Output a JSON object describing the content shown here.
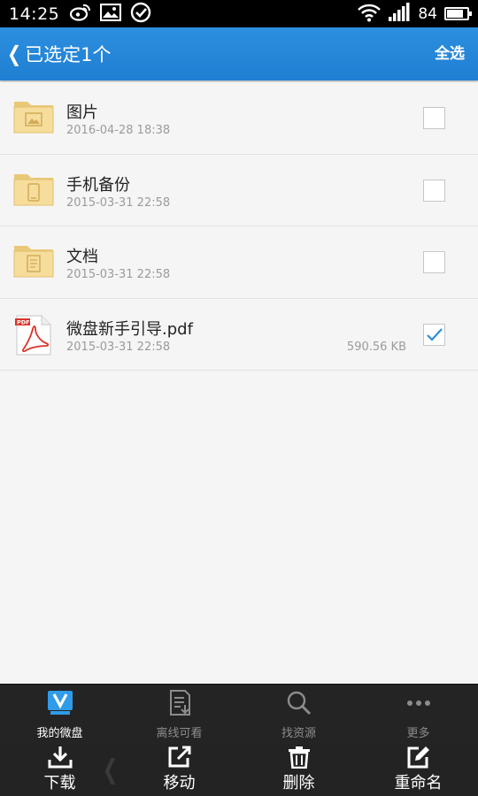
{
  "status_bar": {
    "time": "14:25",
    "battery": "84",
    "battery_level": 0.84,
    "icons": [
      "weibo-icon",
      "image-icon",
      "check-circle-icon",
      "wifi-icon",
      "signal-icon",
      "battery-icon"
    ]
  },
  "header": {
    "back_icon": "chevron-left-icon",
    "title": "已选定1个",
    "select_all_label": "全选",
    "bg_color": "#2288d9"
  },
  "files": [
    {
      "name": "图片",
      "date": "2016-04-28 18:38",
      "size": "",
      "type": "folder",
      "icon": "folder-image-icon",
      "checked": false
    },
    {
      "name": "手机备份",
      "date": "2015-03-31 22:58",
      "size": "",
      "type": "folder",
      "icon": "folder-phone-icon",
      "checked": false
    },
    {
      "name": "文档",
      "date": "2015-03-31 22:58",
      "size": "",
      "type": "folder",
      "icon": "folder-document-icon",
      "checked": false
    },
    {
      "name": "微盘新手引导.pdf",
      "date": "2015-03-31 22:58",
      "size": "590.56 KB",
      "type": "pdf",
      "icon": "pdf-file-icon",
      "checked": true
    }
  ],
  "tabs": [
    {
      "label": "我的微盘",
      "icon": "weipan-icon",
      "active": true
    },
    {
      "label": "离线可看",
      "icon": "offline-doc-icon",
      "active": false
    },
    {
      "label": "找资源",
      "icon": "search-icon",
      "active": false
    },
    {
      "label": "更多",
      "icon": "more-icon",
      "active": false
    }
  ],
  "actions": [
    {
      "label": "下载",
      "icon": "download-icon"
    },
    {
      "label": "移动",
      "icon": "move-icon"
    },
    {
      "label": "删除",
      "icon": "trash-icon"
    },
    {
      "label": "重命名",
      "icon": "rename-icon"
    }
  ],
  "colors": {
    "accent": "#2288d9",
    "check": "#2f8fdc",
    "tab_active": "#3b9ee8"
  }
}
